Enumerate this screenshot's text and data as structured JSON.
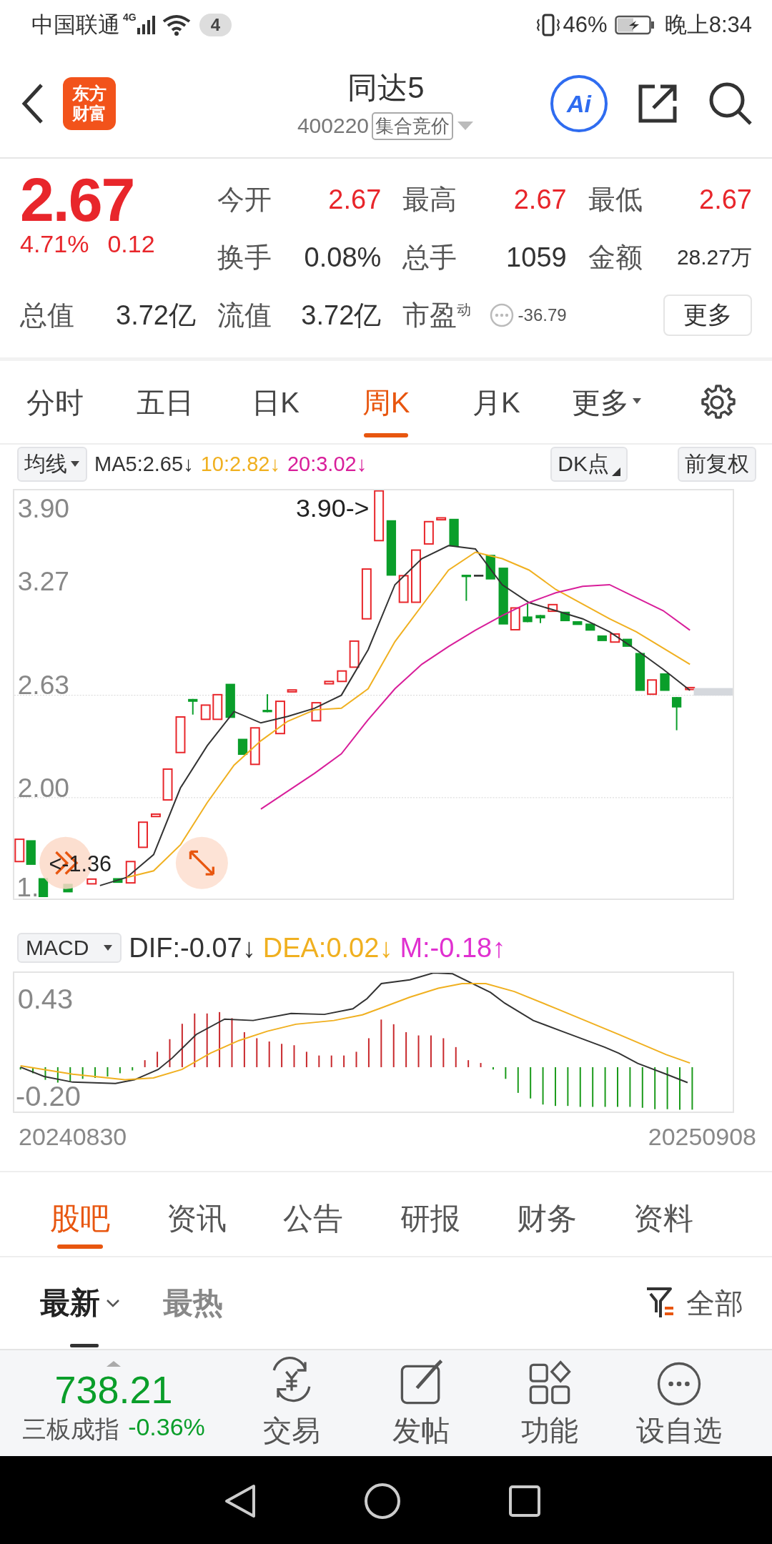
{
  "status_bar": {
    "carrier": "中国联通",
    "network": "4G",
    "badge": "4",
    "battery": "46%",
    "time": "晚上8:34"
  },
  "header": {
    "logo_lines": [
      "东方",
      "财富"
    ],
    "title": "同达5",
    "code": "400220",
    "tag": "集合竞价",
    "ai_button": "Ai"
  },
  "quote": {
    "price": "2.67",
    "change_pct": "4.71%",
    "change": "0.12",
    "stats": [
      {
        "label": "今开",
        "value": "2.67",
        "kind": "price"
      },
      {
        "label": "最高",
        "value": "2.67",
        "kind": "price"
      },
      {
        "label": "最低",
        "value": "2.67",
        "kind": "price"
      },
      {
        "label": "换手",
        "value": "0.08%",
        "kind": "plain"
      },
      {
        "label": "总手",
        "value": "1059",
        "kind": "plain"
      },
      {
        "label": "金额",
        "value": "28.27万",
        "kind": "compact"
      },
      {
        "label": "总值",
        "value": "3.72亿",
        "kind": "plain"
      },
      {
        "label": "流值",
        "value": "3.72亿",
        "kind": "plain"
      },
      {
        "label": "市盈$^{动}$",
        "value": "-36.79",
        "kind": "pe"
      }
    ],
    "more_button": "更多"
  },
  "period_tabs": [
    {
      "label": "分时",
      "selected": false,
      "dropdown": false
    },
    {
      "label": "五日",
      "selected": false,
      "dropdown": false
    },
    {
      "label": "日K",
      "selected": false,
      "dropdown": false
    },
    {
      "label": "周K",
      "selected": true,
      "dropdown": false
    },
    {
      "label": "月K",
      "selected": false,
      "dropdown": false
    },
    {
      "label": "更多",
      "selected": false,
      "dropdown": true
    }
  ],
  "ma_legend": {
    "indicator": "均线",
    "items": [
      {
        "value": ":2.65↓"
      },
      {
        "value": ":2.82↓"
      },
      {
        "value": ":3.02↓"
      }
    ],
    "buttons": [
      "DK点",
      "前复权"
    ]
  },
  "kline": {
    "top_label": "3.90",
    "high_label": "3.90->",
    "low_label": "<-1.36",
    "bottom_label": "1.",
    "chart_data": {
      "type": "line",
      "ylim": [
        1.38,
        3.89
      ],
      "yticks": [
        {
          "value": 3.27,
          "label": "3.27"
        },
        {
          "value": 2.63,
          "label": "2.63"
        },
        {
          "value": 2.0,
          "label": "2.00"
        }
      ],
      "series": [
        {
          "name": "MA5",
          "color": "#333333",
          "values": [
            null,
            null,
            1.46,
            1.51,
            1.65,
            2.06,
            2.32,
            2.53,
            2.46,
            2.5,
            2.55,
            2.63,
            2.91,
            3.31,
            3.47,
            3.55,
            3.53,
            3.31,
            3.2,
            3.15,
            3.1,
            3.02,
            2.91,
            2.79,
            2.66
          ]
        },
        {
          "name": "10",
          "color": "#f0b020",
          "values": [
            null,
            null,
            null,
            1.51,
            1.55,
            1.71,
            1.97,
            2.2,
            2.35,
            2.47,
            2.54,
            2.55,
            2.67,
            2.96,
            3.18,
            3.4,
            3.51,
            3.47,
            3.4,
            3.28,
            3.19,
            3.1,
            3.02,
            2.92,
            2.82
          ]
        },
        {
          "name": "20",
          "color": "#d81e9a",
          "values": [
            null,
            null,
            null,
            null,
            null,
            null,
            null,
            null,
            1.93,
            2.04,
            2.15,
            2.27,
            2.48,
            2.67,
            2.82,
            2.93,
            3.03,
            3.12,
            3.2,
            3.26,
            3.3,
            3.31,
            3.23,
            3.15,
            3.03
          ]
        }
      ]
    }
  },
  "macd": {
    "indicator": "MACD",
    "items": [
      {
        "text": "DIF:-0.07↓",
        "color": "#333333"
      },
      {
        "text": "DEA:0.02↓",
        "color": "#f0b020"
      },
      {
        "text": "M:-0.18↑",
        "color": "#e030d0"
      }
    ],
    "y_labels": [
      "0.43",
      "-0.20"
    ],
    "dates": [
      "20240830",
      "20250908"
    ]
  },
  "news_tabs": [
    {
      "label": "股吧",
      "selected": true
    },
    {
      "label": "资讯",
      "selected": false
    },
    {
      "label": "公告",
      "selected": false
    },
    {
      "label": "研报",
      "selected": false
    },
    {
      "label": "财务",
      "selected": false
    },
    {
      "label": "资料",
      "selected": false
    }
  ],
  "sort_tabs": [
    {
      "label": "最新",
      "selected": true,
      "dropdown": true
    },
    {
      "label": "最热",
      "selected": false,
      "dropdown": false
    }
  ],
  "filter": "全部",
  "bottom_bar": {
    "index_value": "738.21",
    "index_name": "三板成指",
    "index_change": "-0.36%",
    "actions": [
      {
        "label": "交易",
        "kind": "trade"
      },
      {
        "label": "发帖",
        "kind": "post"
      },
      {
        "label": "功能",
        "kind": "features"
      },
      {
        "label": "设自选",
        "kind": "watchlist"
      }
    ]
  }
}
